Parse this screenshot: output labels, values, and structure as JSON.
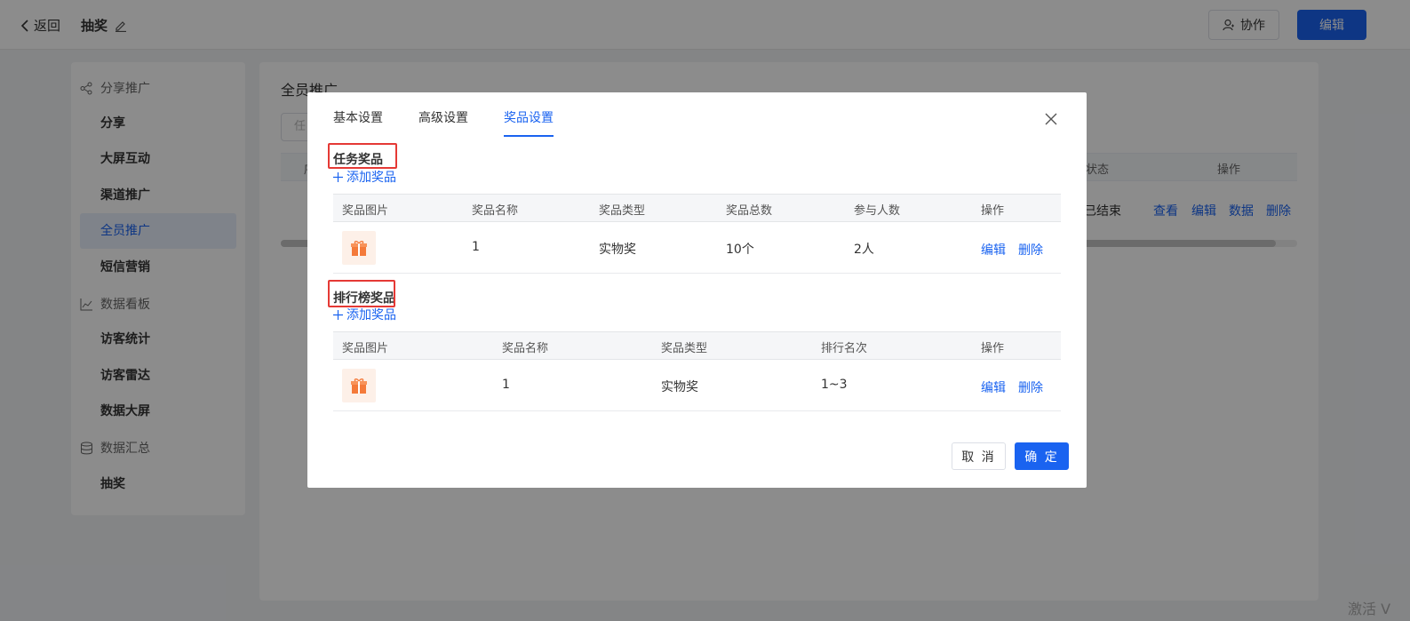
{
  "topbar": {
    "back_label": "返回",
    "page_name": "抽奖",
    "collab_label": "协作",
    "edit_label": "编辑"
  },
  "sidebar": {
    "groups": [
      {
        "label": "分享推广",
        "icon": "share-icon"
      },
      {
        "label": "数据看板",
        "icon": "chart-line-icon"
      },
      {
        "label": "数据汇总",
        "icon": "database-icon"
      }
    ],
    "items": [
      {
        "label": "分享",
        "active": false
      },
      {
        "label": "大屏互动",
        "active": false
      },
      {
        "label": "渠道推广",
        "active": false
      },
      {
        "label": "全员推广",
        "active": true
      },
      {
        "label": "短信营销",
        "active": false
      },
      {
        "label": "访客统计",
        "active": false
      },
      {
        "label": "访客雷达",
        "active": false
      },
      {
        "label": "数据大屏",
        "active": false
      },
      {
        "label": "抽奖",
        "active": false
      }
    ]
  },
  "main": {
    "title": "全员推广",
    "search_placeholder": "任",
    "header_first_char": "序",
    "header_status": "状态",
    "header_actions": "操作",
    "row_status": "已结束",
    "row_actions": [
      "查看",
      "编辑",
      "数据",
      "删除"
    ]
  },
  "watermark": "激活 V",
  "dialog": {
    "tabs": [
      {
        "label": "基本设置",
        "active": false
      },
      {
        "label": "高级设置",
        "active": false
      },
      {
        "label": "奖品设置",
        "active": true
      }
    ],
    "task_prizes": {
      "title": "任务奖品",
      "add_label": "添加奖品",
      "columns": [
        "奖品图片",
        "奖品名称",
        "奖品类型",
        "奖品总数",
        "参与人数",
        "操作"
      ],
      "rows": [
        {
          "name": "1",
          "type": "实物奖",
          "total": "10个",
          "participants": "2人",
          "edit": "编辑",
          "delete": "删除"
        }
      ]
    },
    "rank_prizes": {
      "title": "排行榜奖品",
      "add_label": "添加奖品",
      "columns": [
        "奖品图片",
        "奖品名称",
        "奖品类型",
        "排行名次",
        "操作"
      ],
      "rows": [
        {
          "name": "1",
          "type": "实物奖",
          "rank": "1~3",
          "edit": "编辑",
          "delete": "删除"
        }
      ]
    },
    "cancel_label": "取 消",
    "ok_label": "确 定"
  },
  "colors": {
    "accent": "#1a63f0",
    "highlight": "#e53935",
    "overlay": "rgba(0,0,0,0.45)"
  }
}
